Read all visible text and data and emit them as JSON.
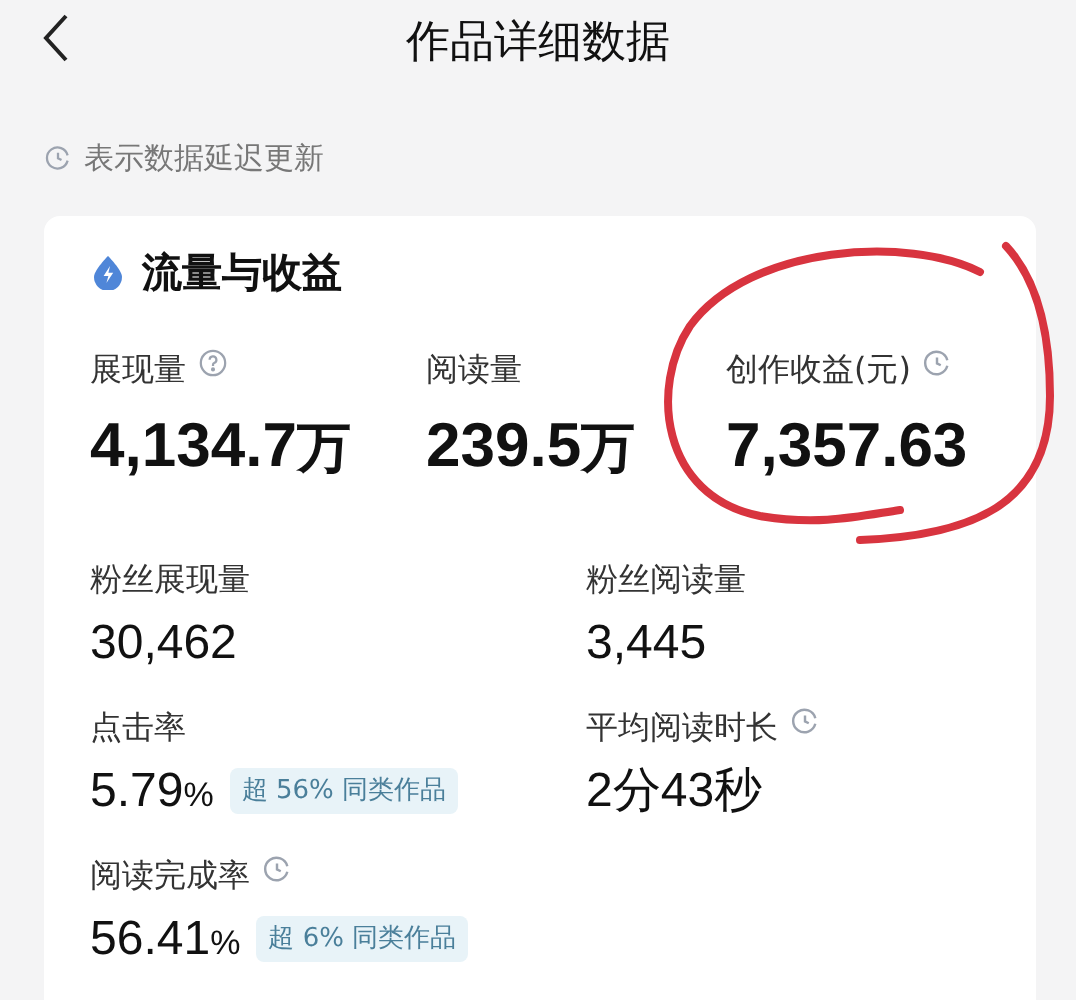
{
  "header": {
    "title": "作品详细数据"
  },
  "notice": {
    "text": "表示数据延迟更新"
  },
  "card": {
    "title": "流量与收益",
    "top_metrics": [
      {
        "label": "展现量",
        "kind": "help",
        "value": "4,134.7",
        "unit": "万"
      },
      {
        "label": "阅读量",
        "kind": "plain",
        "value": "239.5",
        "unit": "万"
      },
      {
        "label": "创作收益(元)",
        "kind": "delayed",
        "value": "7,357.63",
        "circled": true
      }
    ],
    "metrics": [
      {
        "label": "粉丝展现量",
        "kind": "plain",
        "value": "30,462"
      },
      {
        "label": "粉丝阅读量",
        "kind": "plain",
        "value": "3,445"
      },
      {
        "label": "点击率",
        "kind": "plain",
        "value": "5.79",
        "unit": "%",
        "badge": "超 56% 同类作品"
      },
      {
        "label": "平均阅读时长",
        "kind": "delayed",
        "value": "2分43秒"
      },
      {
        "label": "阅读完成率",
        "kind": "delayed",
        "value": "56.41",
        "unit": "%",
        "badge": "超 6% 同类作品"
      }
    ]
  }
}
